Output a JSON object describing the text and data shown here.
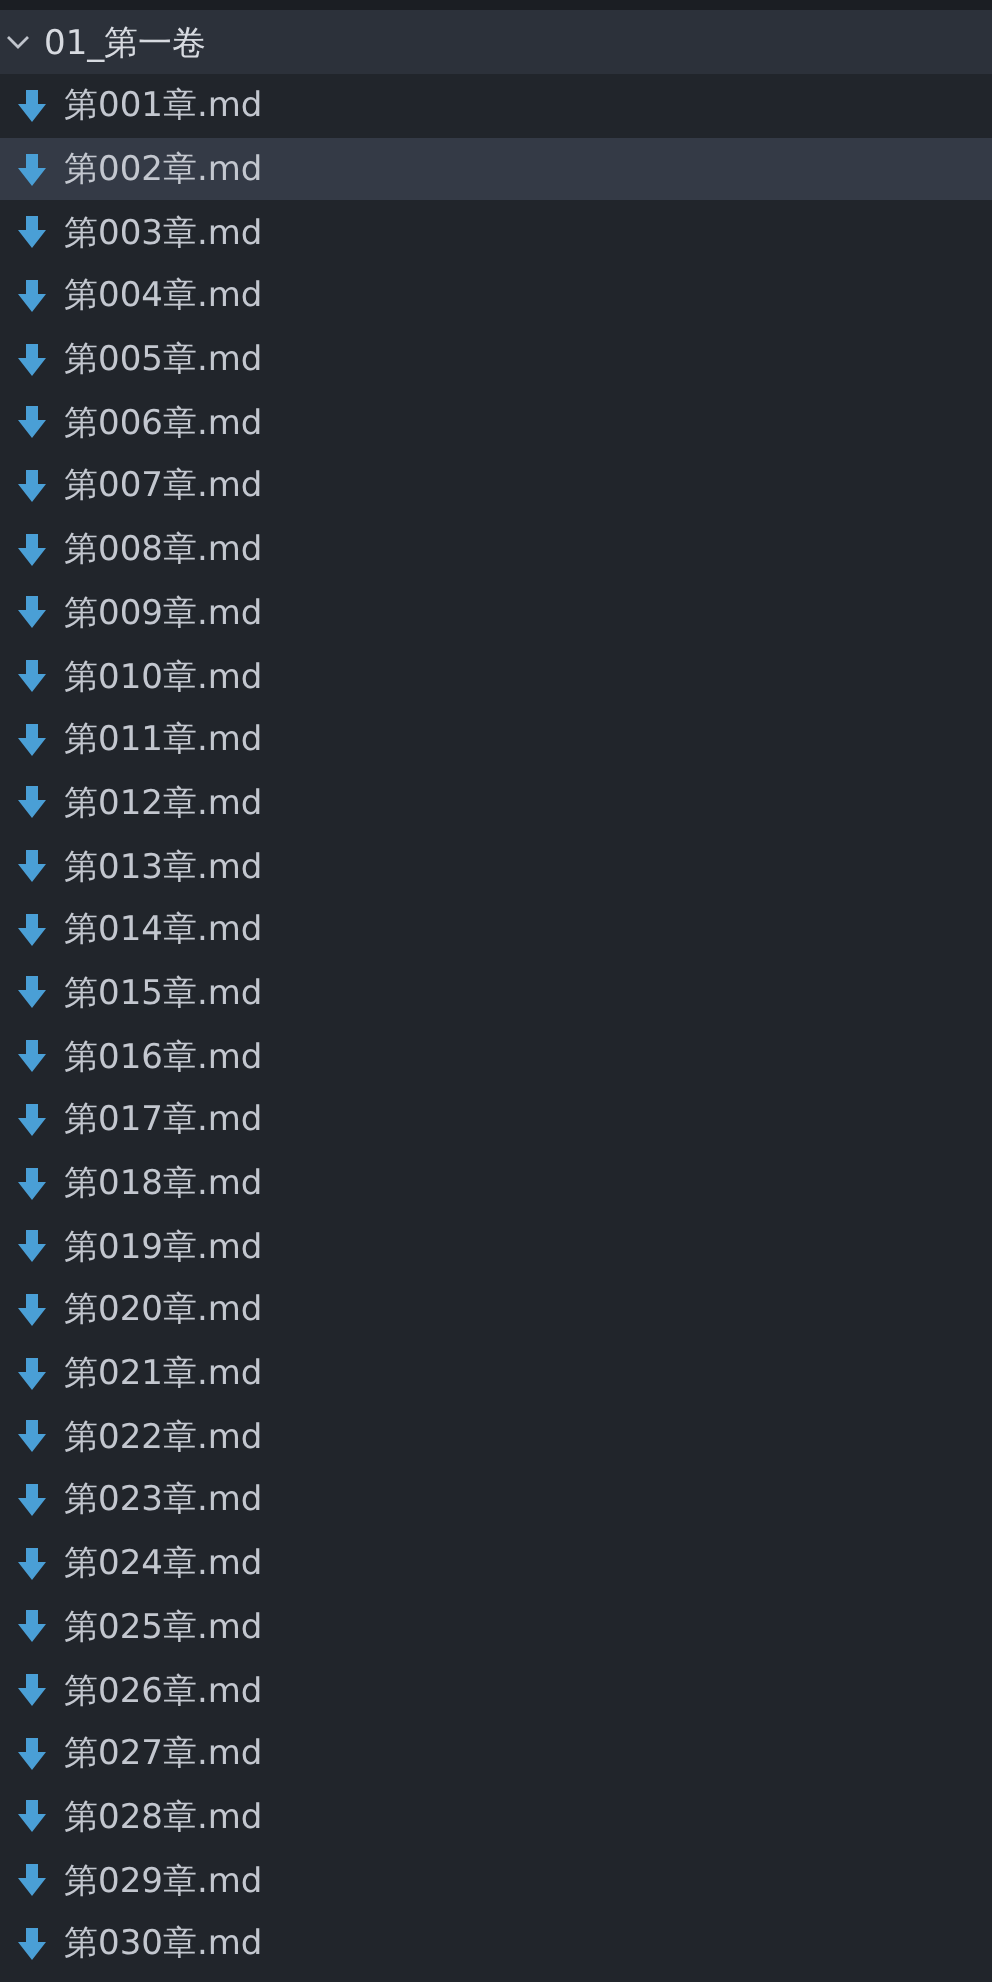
{
  "folder": {
    "name": "01_第一卷",
    "expanded": true
  },
  "files": [
    {
      "name": "第001章.md",
      "selected": false
    },
    {
      "name": "第002章.md",
      "selected": true
    },
    {
      "name": "第003章.md",
      "selected": false
    },
    {
      "name": "第004章.md",
      "selected": false
    },
    {
      "name": "第005章.md",
      "selected": false
    },
    {
      "name": "第006章.md",
      "selected": false
    },
    {
      "name": "第007章.md",
      "selected": false
    },
    {
      "name": "第008章.md",
      "selected": false
    },
    {
      "name": "第009章.md",
      "selected": false
    },
    {
      "name": "第010章.md",
      "selected": false
    },
    {
      "name": "第011章.md",
      "selected": false
    },
    {
      "name": "第012章.md",
      "selected": false
    },
    {
      "name": "第013章.md",
      "selected": false
    },
    {
      "name": "第014章.md",
      "selected": false
    },
    {
      "name": "第015章.md",
      "selected": false
    },
    {
      "name": "第016章.md",
      "selected": false
    },
    {
      "name": "第017章.md",
      "selected": false
    },
    {
      "name": "第018章.md",
      "selected": false
    },
    {
      "name": "第019章.md",
      "selected": false
    },
    {
      "name": "第020章.md",
      "selected": false
    },
    {
      "name": "第021章.md",
      "selected": false
    },
    {
      "name": "第022章.md",
      "selected": false
    },
    {
      "name": "第023章.md",
      "selected": false
    },
    {
      "name": "第024章.md",
      "selected": false
    },
    {
      "name": "第025章.md",
      "selected": false
    },
    {
      "name": "第026章.md",
      "selected": false
    },
    {
      "name": "第027章.md",
      "selected": false
    },
    {
      "name": "第028章.md",
      "selected": false
    },
    {
      "name": "第029章.md",
      "selected": false
    },
    {
      "name": "第030章.md",
      "selected": false
    }
  ]
}
